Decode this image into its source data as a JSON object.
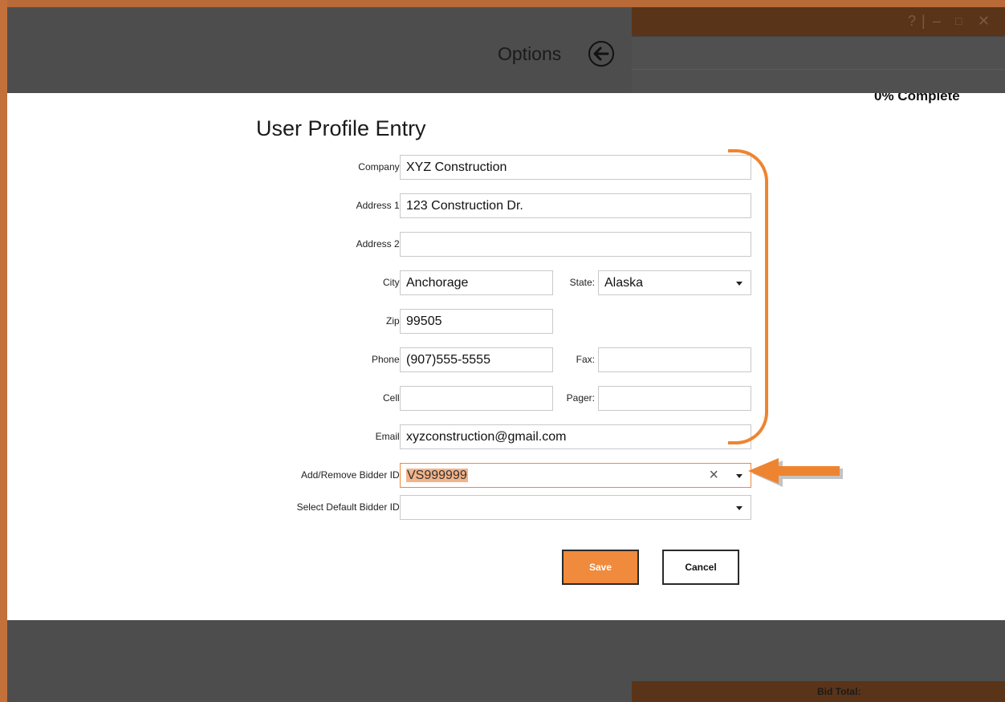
{
  "window": {
    "help_label": "?",
    "separator": "|",
    "minimize_label": "–",
    "maximize_label": "□",
    "close_label": "✕"
  },
  "header": {
    "title": "Options",
    "progress_partial": "0% Complete"
  },
  "form": {
    "title": "User Profile Entry",
    "company": {
      "label": "Company:",
      "value": "XYZ Construction"
    },
    "address1": {
      "label": "Address 1:",
      "value": "123 Construction Dr."
    },
    "address2": {
      "label": "Address 2:",
      "value": ""
    },
    "city": {
      "label": "City:",
      "value": "Anchorage"
    },
    "state": {
      "label": "State:",
      "value": "Alaska"
    },
    "zip": {
      "label": "Zip:",
      "value": "99505"
    },
    "phone": {
      "label": "Phone:",
      "value": "(907)555-5555"
    },
    "fax": {
      "label": "Fax:",
      "value": ""
    },
    "cell": {
      "label": "Cell:",
      "value": ""
    },
    "pager": {
      "label": "Pager:",
      "value": ""
    },
    "email": {
      "label": "Email:",
      "value": "xyzconstruction@gmail.com"
    },
    "bidder_id": {
      "label": "Add/Remove Bidder ID:",
      "value": "VS999999",
      "clear": "×"
    },
    "default_bidder": {
      "label": "Select Default Bidder ID:",
      "value": ""
    }
  },
  "buttons": {
    "save": "Save",
    "cancel": "Cancel"
  },
  "footer": {
    "bid_total": "Bid Total:"
  },
  "colors": {
    "accent": "#f08a3c",
    "brown": "#5a3418",
    "chrome": "#4d4d4d"
  }
}
